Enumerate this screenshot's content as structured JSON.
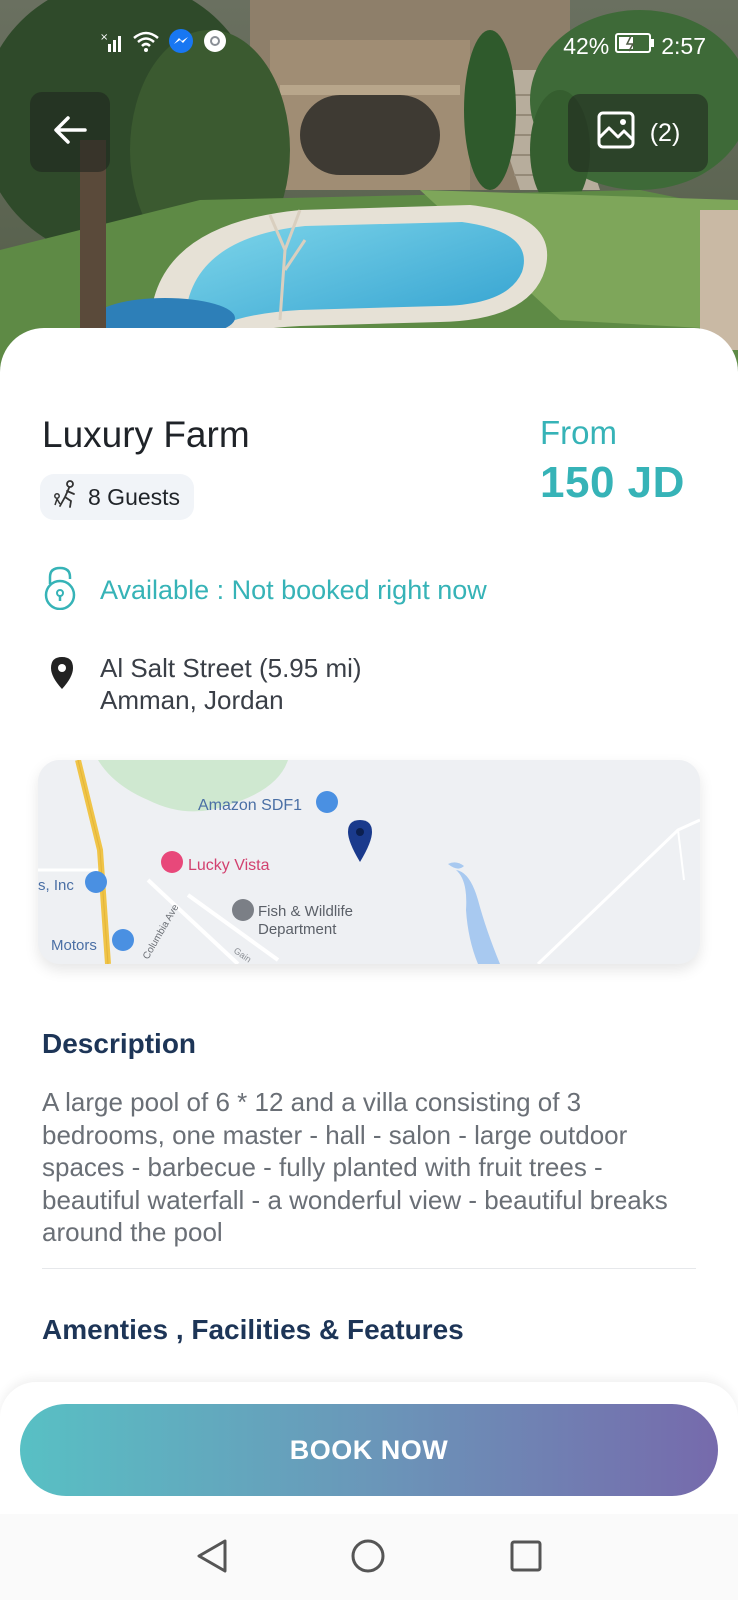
{
  "status_bar": {
    "battery": "42%",
    "time": "2:57",
    "icons": [
      "signal-icon",
      "wifi-icon",
      "messenger-icon",
      "chrome-icon",
      "battery-icon"
    ]
  },
  "gallery": {
    "count_label": "(2)"
  },
  "property": {
    "name": "Luxury Farm",
    "guests": "8 Guests",
    "price_from": "From",
    "price": "150 JD",
    "availability": "Available : Not booked right now",
    "address_line1": "Al Salt Street (5.95 mi)",
    "address_line2": "Amman, Jordan"
  },
  "map": {
    "labels": {
      "amazon": "Amazon SDF1",
      "lucky_vista": "Lucky Vista",
      "inc": "s, Inc",
      "fish_line1": "Fish & Wildlife",
      "fish_line2": "Department",
      "motors": "Motors",
      "columbia": "Columbia Ave",
      "gain": "Gain"
    }
  },
  "description": {
    "title": "Description",
    "text": "A large pool of 6 * 12 and a villa consisting of 3 bedrooms, one master - hall - salon - large outdoor spaces - barbecue - fully planted with fruit trees - beautiful waterfall - a wonderful view - beautiful breaks around the pool"
  },
  "amenities": {
    "title": "Amenties , Facilities & Features"
  },
  "cta": {
    "book_label": "BOOK NOW"
  },
  "colors": {
    "accent_teal": "#36b3b7",
    "heading_navy": "#1d3557",
    "gradient_start": "#58c0c4",
    "gradient_end": "#766aac"
  }
}
